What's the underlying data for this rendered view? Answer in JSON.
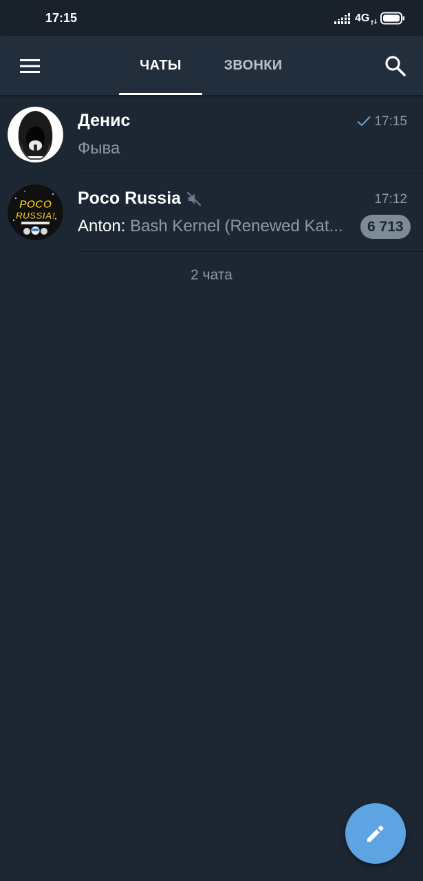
{
  "status_bar": {
    "time": "17:15",
    "network": "4G",
    "icons": [
      "signal-icon",
      "network-arrows-icon",
      "battery-icon"
    ]
  },
  "header": {
    "menu_icon": "menu-icon",
    "tabs": [
      {
        "label": "ЧАТЫ",
        "active": true
      },
      {
        "label": "ЗВОНКИ",
        "active": false
      }
    ],
    "search_icon": "search-icon"
  },
  "chats": [
    {
      "name": "Денис",
      "time": "17:15",
      "preview": "Фыва",
      "read_receipt": "check-icon",
      "avatar": "hooded-figure-avatar"
    },
    {
      "name": "Poco Russia",
      "muted": true,
      "time": "17:12",
      "preview_sender": "Anton: ",
      "preview_text": "Bash Kernel (Renewed Kat...",
      "unread_count": "6 713",
      "avatar": "poco-russia-logo",
      "avatar_text": "POCO RUSSIA!"
    }
  ],
  "footer": {
    "chat_count": "2 чата"
  },
  "fab": {
    "icon": "pencil-icon"
  },
  "colors": {
    "background": "#1d2733",
    "header": "#232e3c",
    "status_bar": "#19212b",
    "accent": "#5ea4e2",
    "muted_text": "#8e99a6",
    "badge": "#7d8a97"
  }
}
